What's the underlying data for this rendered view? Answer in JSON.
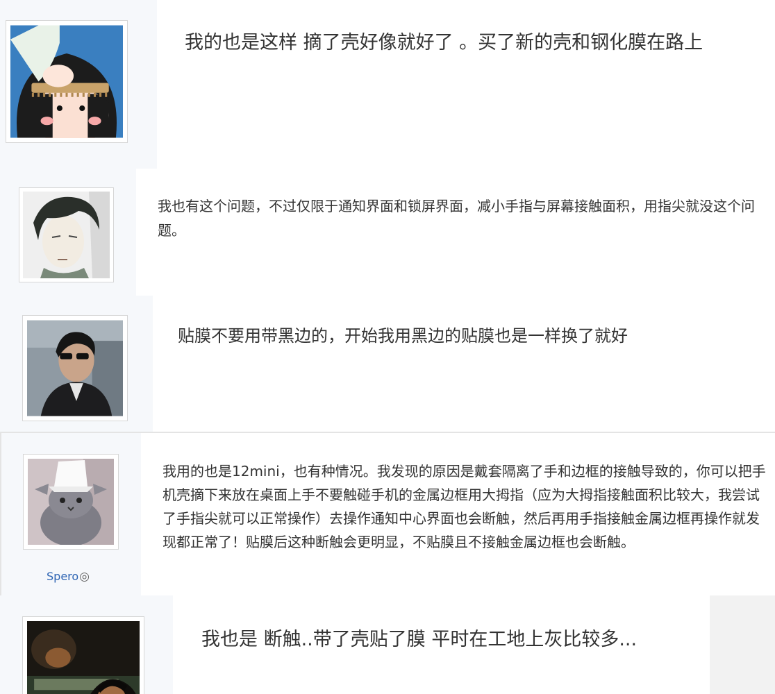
{
  "posts": [
    {
      "avatar": "avatar-girl-comb",
      "text": "我的也是这样 摘了壳好像就好了 。买了新的壳和钢化膜在路上"
    },
    {
      "avatar": "avatar-anime-man",
      "text": "我也有这个问题，不过仅限于通知界面和锁屏界面，减小手指与屏幕接触面积，用指尖就没这个问题。"
    },
    {
      "avatar": "avatar-man-sunglasses",
      "text": "贴膜不要用带黑边的，开始我用黑边的贴膜也是一样换了就好"
    },
    {
      "avatar": "avatar-cat",
      "username": "Spero",
      "badge": "◎",
      "text": "我用的也是12mini，也有种情况。我发现的原因是戴套隔离了手和边框的接触导致的，你可以把手机壳摘下来放在桌面上手不要触碰手机的金属边框用大拇指（应为大拇指接触面积比较大，我尝试了手指尖就可以正常操作）去操作通知中心界面也会断触，然后再用手指接触金属边框再操作就发现都正常了！贴膜后这种断触会更明显，不贴膜且不接触金属边框也会断触。"
    },
    {
      "avatar": "avatar-dark-photo",
      "text": "我也是 断触..带了壳贴了膜 平时在工地上灰比较多..."
    }
  ],
  "colors": {
    "text": "#333333",
    "username": "#2d64b3",
    "gutter": "#f6f8fb",
    "border": "#d6d6d6"
  }
}
